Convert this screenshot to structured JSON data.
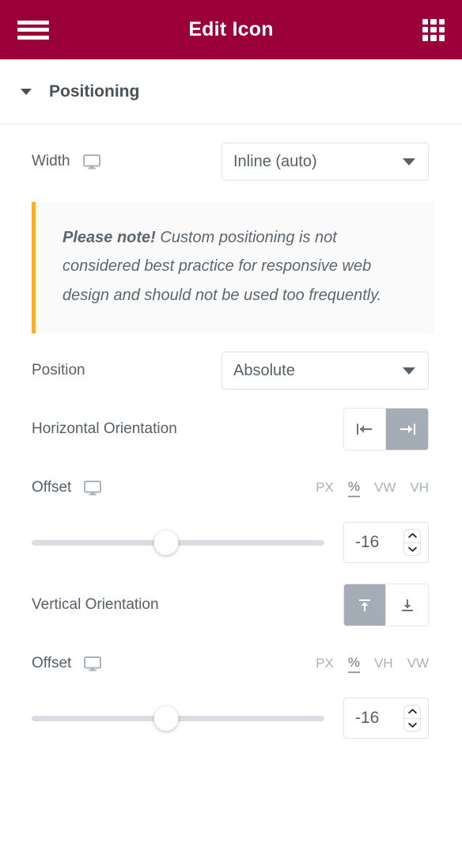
{
  "header": {
    "title": "Edit Icon",
    "menu_icon": "hamburger-icon",
    "apps_icon": "grid-apps-icon"
  },
  "section": {
    "title": "Positioning",
    "collapse_icon": "caret-down-icon"
  },
  "width": {
    "label": "Width",
    "device_icon": "desktop-icon",
    "value": "Inline (auto)",
    "caret_icon": "chevron-down-icon"
  },
  "note": {
    "bold_prefix": "Please note!",
    "body": " Custom positioning is not considered best practice for responsive web design and should not be used too frequently.",
    "accent_color": "#f5b12b"
  },
  "position": {
    "label": "Position",
    "value": "Absolute",
    "caret_icon": "chevron-down-icon"
  },
  "horizontal_orientation": {
    "label": "Horizontal Orientation",
    "options": [
      {
        "name": "align-left-icon",
        "active": false
      },
      {
        "name": "align-right-icon",
        "active": true
      }
    ]
  },
  "offset_horizontal": {
    "label": "Offset",
    "device_icon": "desktop-icon",
    "units": [
      "PX",
      "%",
      "VW",
      "VH"
    ],
    "active_unit": "%",
    "value": "-16",
    "slider_percent": 46
  },
  "vertical_orientation": {
    "label": "Vertical Orientation",
    "options": [
      {
        "name": "align-top-icon",
        "active": true
      },
      {
        "name": "align-bottom-icon",
        "active": false
      }
    ]
  },
  "offset_vertical": {
    "label": "Offset",
    "device_icon": "desktop-icon",
    "units": [
      "PX",
      "%",
      "VH",
      "VW"
    ],
    "active_unit": "%",
    "value": "-16",
    "slider_percent": 46
  },
  "colors": {
    "header_bg": "#9b0039",
    "text": "#566069",
    "toggle_active_bg": "#a4adb6",
    "track": "#dadee2"
  }
}
